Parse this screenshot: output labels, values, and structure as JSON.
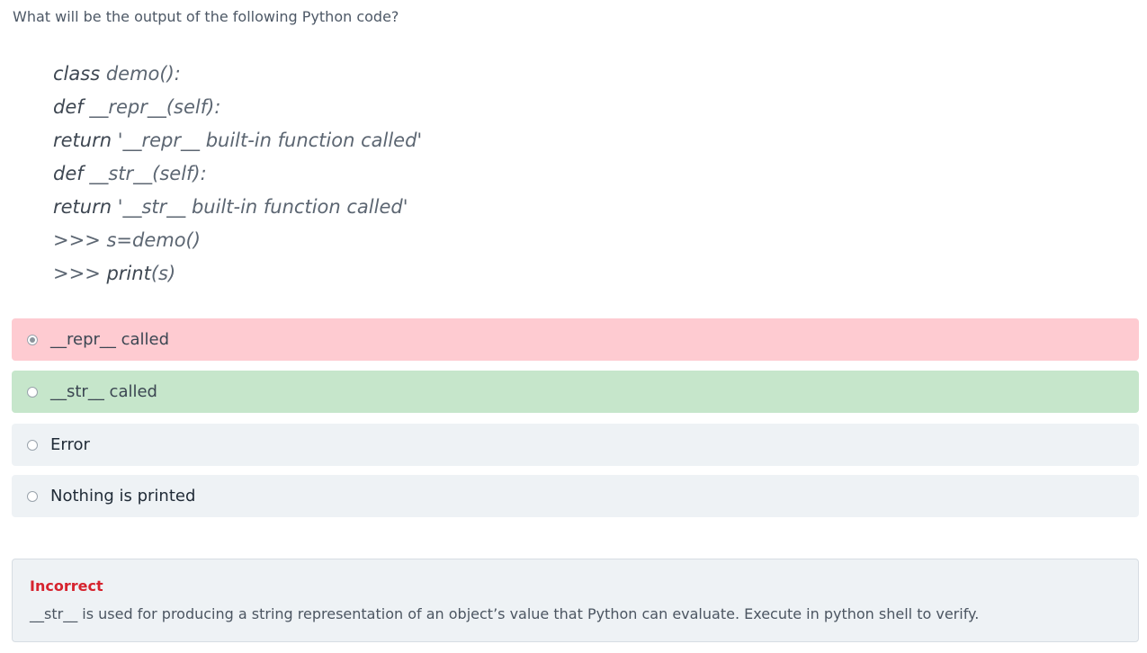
{
  "question": "What will be the output of the following Python code?",
  "code_lines": [
    {
      "kw": "class",
      "rest": " demo():"
    },
    {
      "kw": "def",
      "rest": " __repr__(self):"
    },
    {
      "kw": "return",
      "rest": " '__repr__ built-in function called'"
    },
    {
      "kw": "def",
      "rest": " __str__(self):"
    },
    {
      "kw": "return",
      "rest": " '__str__ built-in function called'"
    },
    {
      "kw": "",
      "rest": ">>> s=demo()"
    },
    {
      "kw": "print",
      "prefix": ">>> ",
      "rest": "(s)"
    }
  ],
  "options": [
    {
      "label": "__repr__ called",
      "state": "wrong",
      "selected": true
    },
    {
      "label": "__str__ called",
      "state": "correct",
      "selected": false
    },
    {
      "label": "Error",
      "state": "neutral",
      "selected": false
    },
    {
      "label": "Nothing is printed",
      "state": "neutral",
      "selected": false
    }
  ],
  "feedback": {
    "status": "Incorrect",
    "explanation": "__str__ is used for producing a string representation of an object’s value that Python can evaluate. Execute in python shell to verify."
  },
  "colors": {
    "wrong_bg": "#fecbd1",
    "correct_bg": "#c6e6cb",
    "neutral_bg": "#eef2f5",
    "incorrect_text": "#d6232e"
  },
  "icons": {
    "radio_selected": "radio-selected-icon",
    "radio_unselected": "radio-unselected-icon"
  }
}
